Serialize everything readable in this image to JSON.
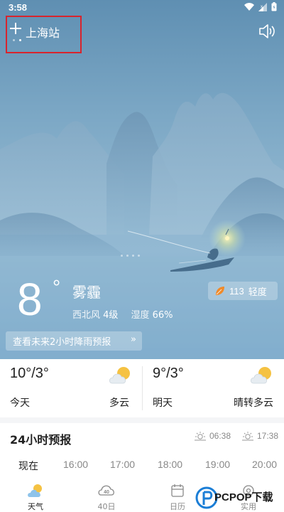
{
  "status_bar": {
    "time": "3:58"
  },
  "header": {
    "city": "上海站"
  },
  "current": {
    "temperature": "8",
    "unit": "°",
    "condition": "雾霾",
    "wind_direction": "西北风",
    "wind_level": "4级",
    "humidity_label": "湿度",
    "humidity_value": "66%",
    "rain_forecast_button": "查看未来2小时降雨预报",
    "rain_forecast_arrows": "»"
  },
  "aqi": {
    "value": "113",
    "level": "轻度"
  },
  "daily": [
    {
      "range": "10°/3°",
      "day": "今天",
      "condition": "多云"
    },
    {
      "range": "9°/3°",
      "day": "明天",
      "condition": "晴转多云"
    }
  ],
  "hourly": {
    "title": "24小时预报",
    "sunrise": "06:38",
    "sunset": "17:38",
    "hours": [
      "现在",
      "16:00",
      "17:00",
      "18:00",
      "19:00",
      "20:00"
    ]
  },
  "nav": [
    {
      "label": "天气",
      "icon": "weather-icon",
      "active": true
    },
    {
      "label": "40日",
      "icon": "forty-day-icon",
      "badge": "40"
    },
    {
      "label": "日历",
      "icon": "calendar-icon"
    },
    {
      "label": "实用",
      "icon": "tools-icon"
    }
  ],
  "watermark": {
    "text": "PCPOP下载"
  },
  "colors": {
    "aqi_orange": "#f08a2a",
    "highlight_red": "#d8242d",
    "sun_yellow": "#f5c242"
  }
}
